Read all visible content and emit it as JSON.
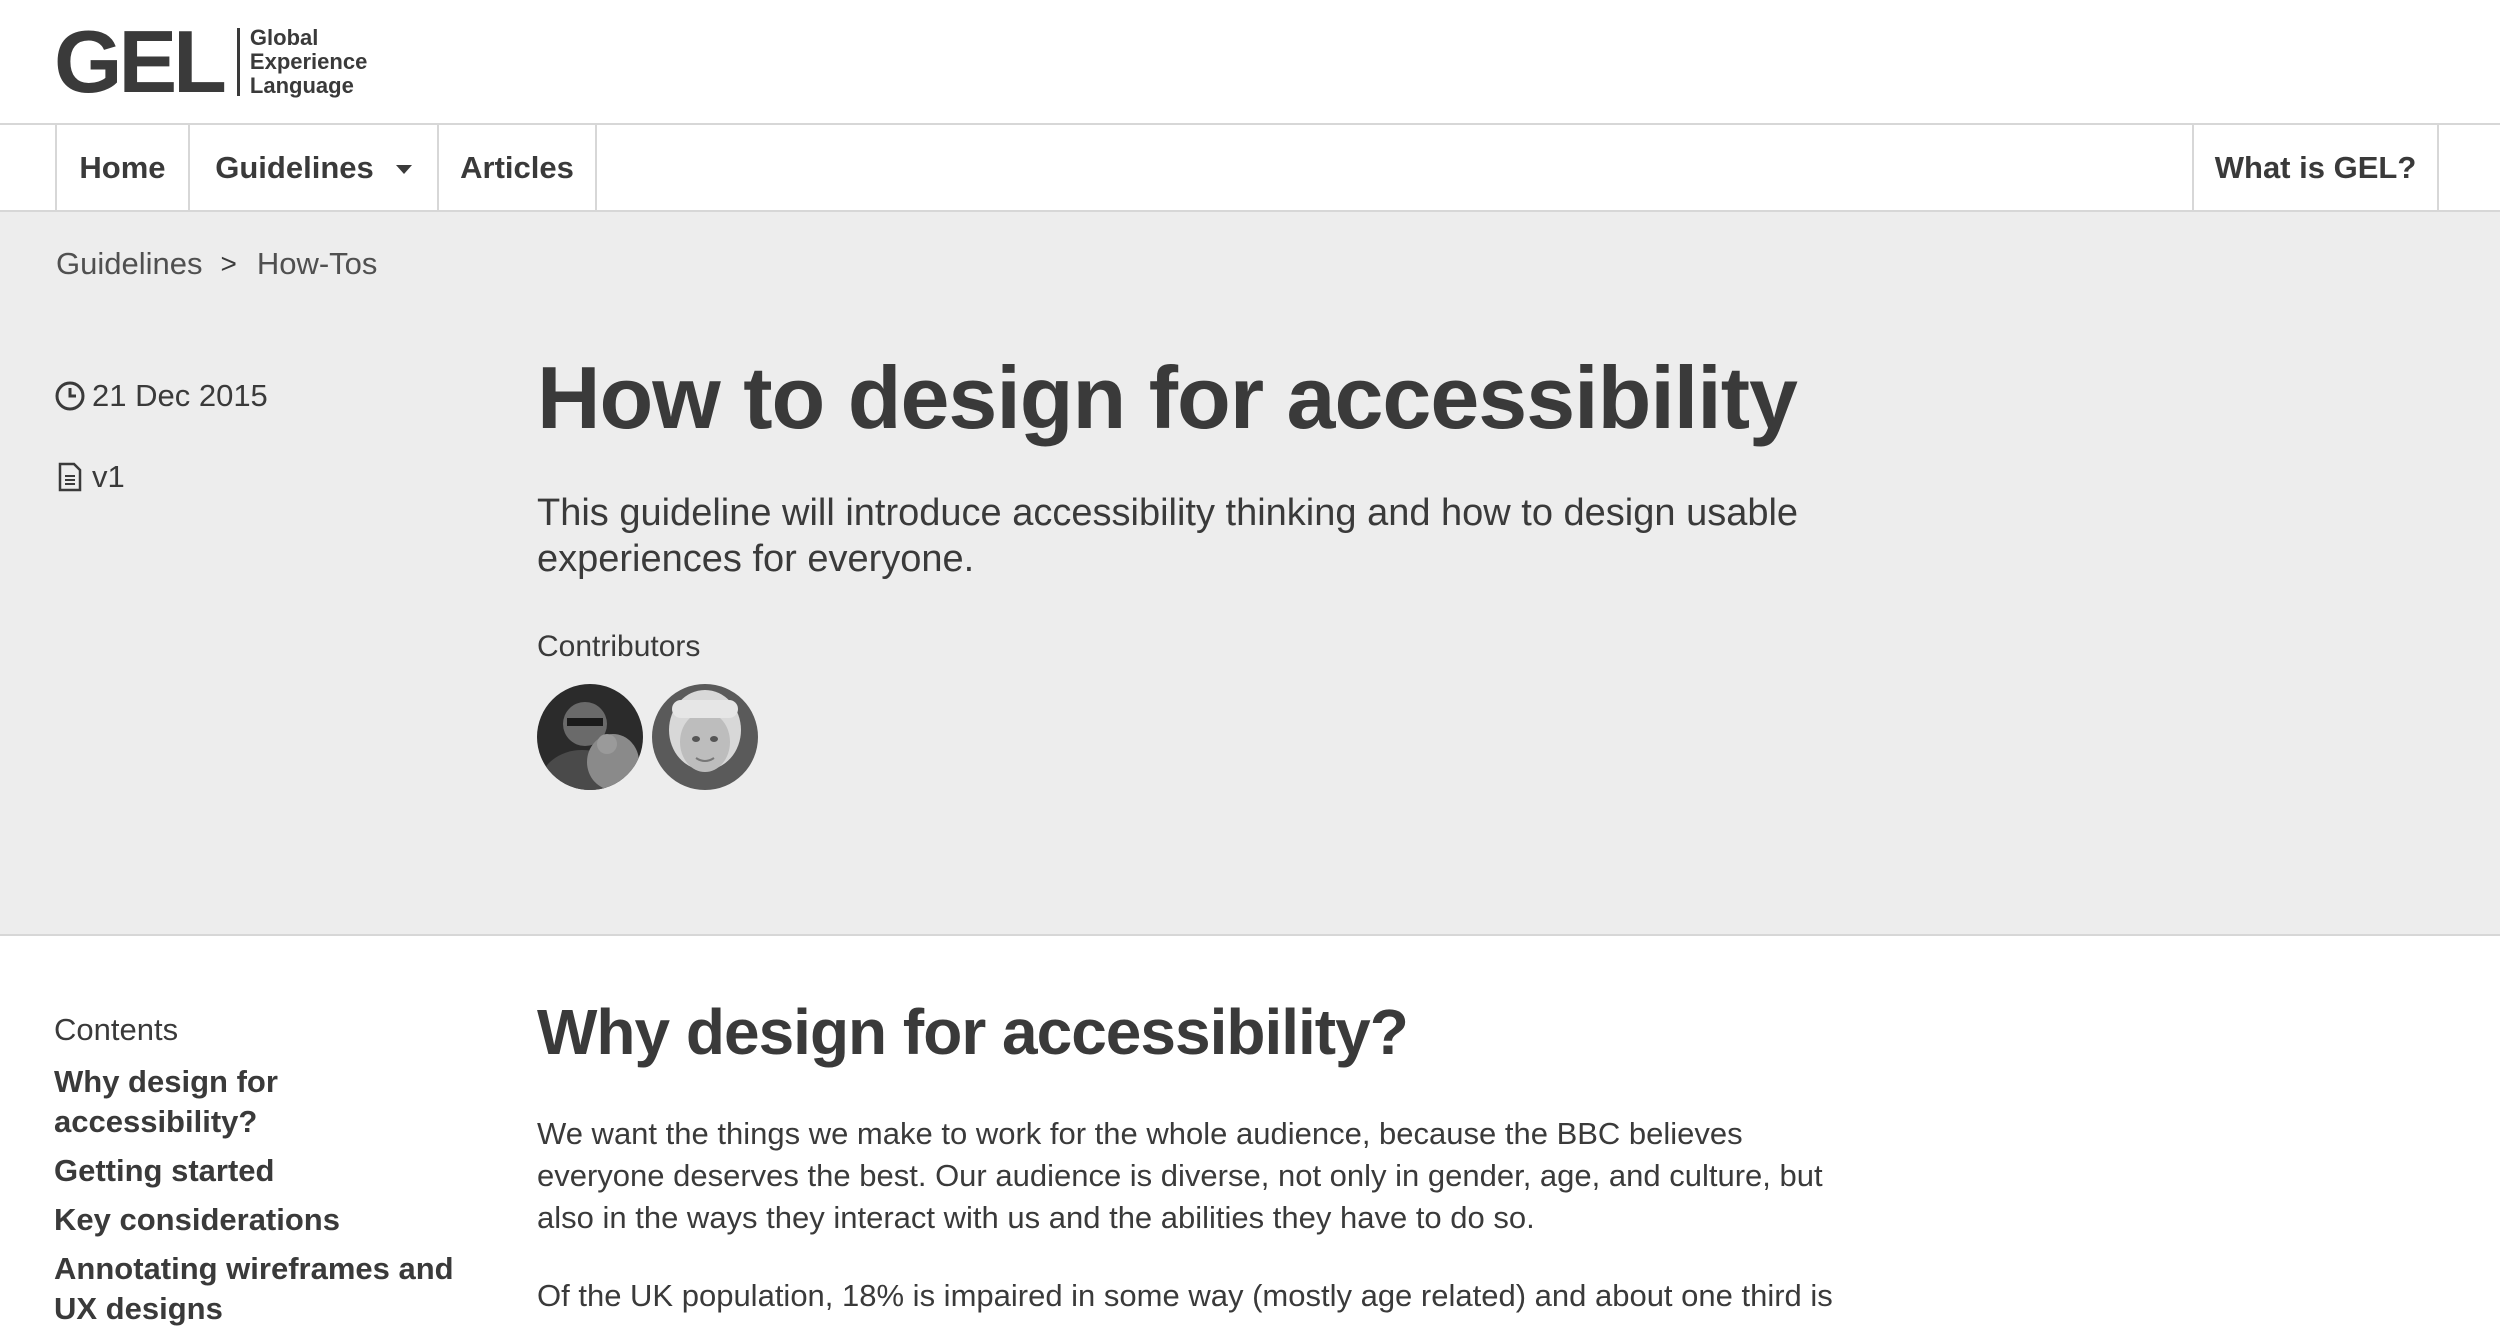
{
  "logo": {
    "mark": "GEL",
    "line1": "Global",
    "line2": "Experience",
    "line3": "Language"
  },
  "nav": {
    "home": "Home",
    "guidelines": "Guidelines",
    "articles": "Articles",
    "what_is": "What is GEL?"
  },
  "breadcrumb": {
    "parent": "Guidelines",
    "separator": ">",
    "current": "How-Tos"
  },
  "meta": {
    "date": "21 Dec 2015",
    "version": "v1"
  },
  "hero": {
    "title": "How to design for accessibility",
    "intro": "This guideline will introduce accessibility thinking and how to design usable experiences for everyone.",
    "contributors_label": "Contributors"
  },
  "toc": {
    "label": "Contents",
    "items": [
      "Why design for accessibility?",
      "Getting started",
      "Key considerations",
      "Annotating wireframes and UX designs"
    ]
  },
  "content": {
    "section_title": "Why design for accessibility?",
    "paragraph_1": "We want the things we make to work for the whole audience, because the BBC believes everyone deserves the best. Our audience is diverse, not only in gender, age, and culture, but also in the ways they interact with us and the abilities they have to do so.",
    "paragraph_2": "Of the UK population, 18% is impaired in some way (mostly age related) and about one third is"
  },
  "colors": {
    "text": "#3a3a3a",
    "hero_bg": "#ededed",
    "border": "#d7d7d7"
  },
  "icons": {
    "date": "clock-icon",
    "version": "document-icon",
    "dropdown": "caret-down-icon"
  }
}
